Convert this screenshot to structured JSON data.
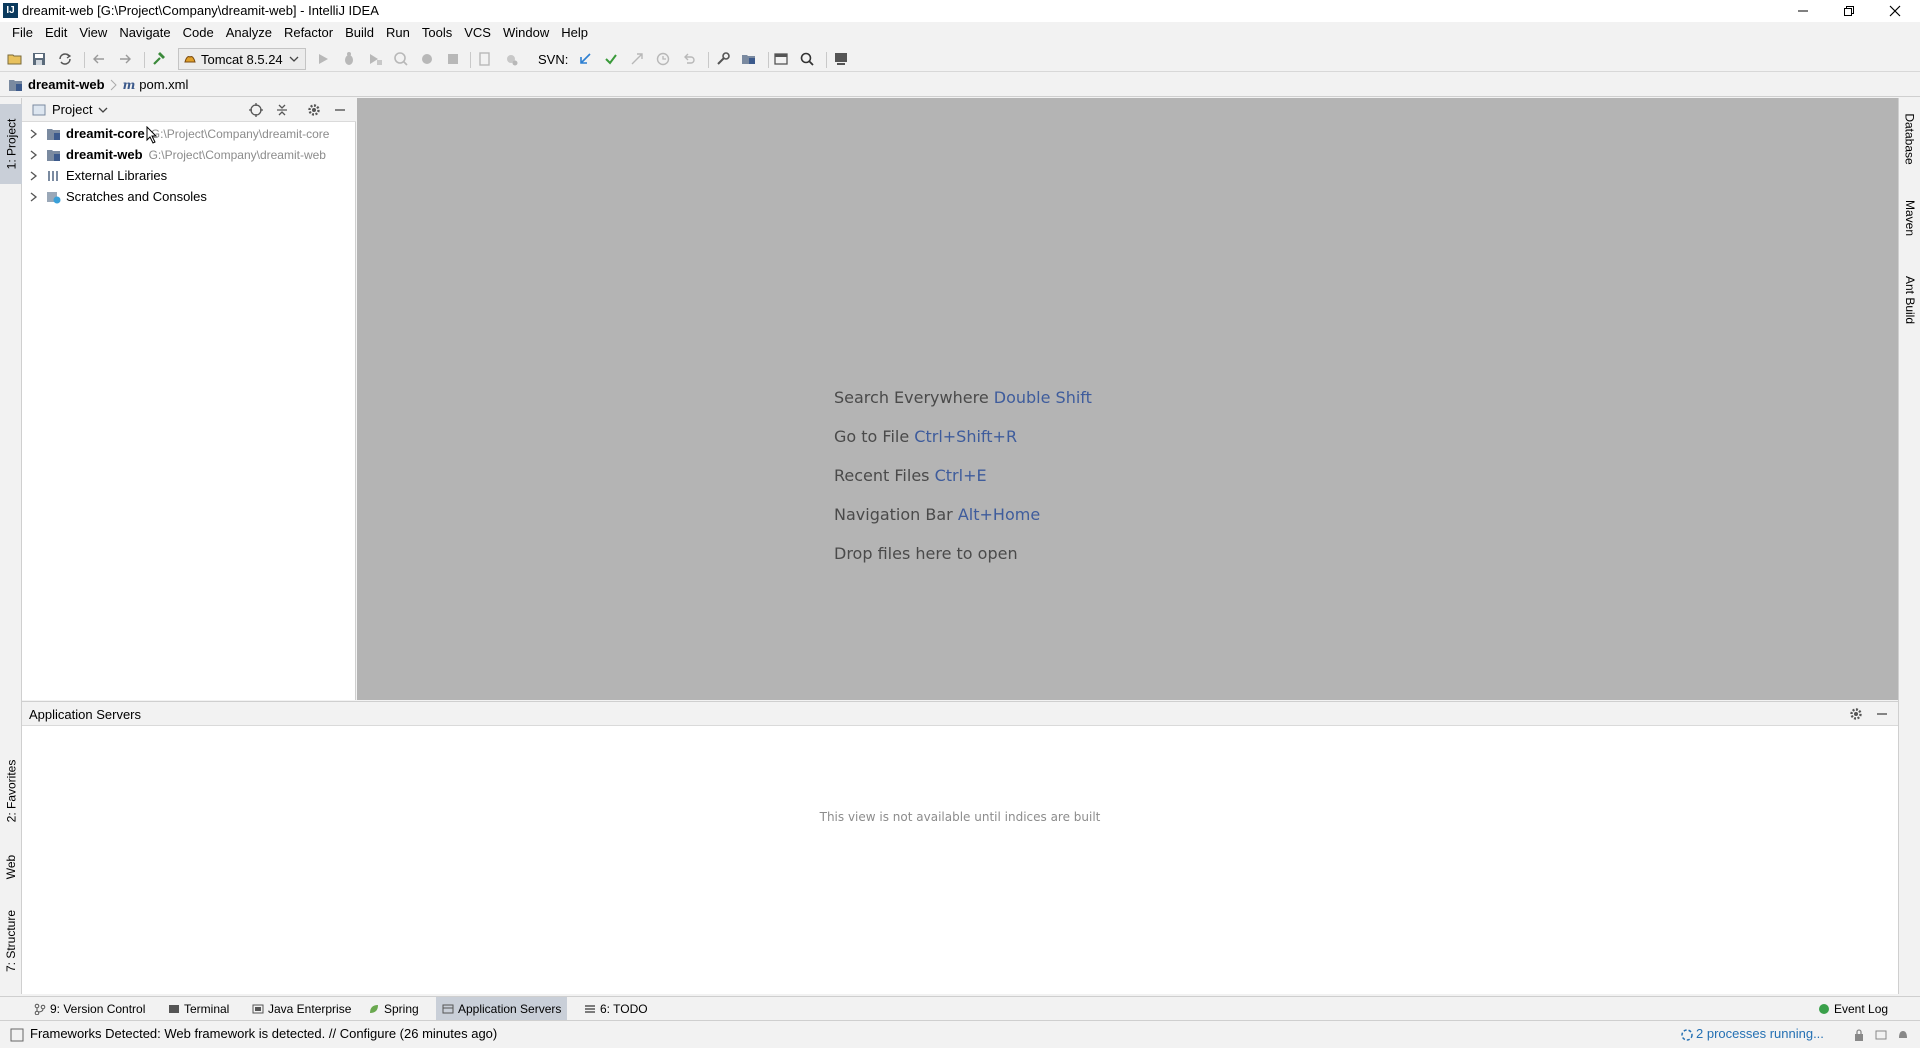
{
  "window": {
    "title": "dreamit-web [G:\\Project\\Company\\dreamit-web] - IntelliJ IDEA",
    "app_icon_letter": "IJ"
  },
  "menu": [
    "File",
    "Edit",
    "View",
    "Navigate",
    "Code",
    "Analyze",
    "Refactor",
    "Build",
    "Run",
    "Tools",
    "VCS",
    "Window",
    "Help"
  ],
  "toolbar": {
    "run_config": "Tomcat 8.5.24",
    "svn_label": "SVN:"
  },
  "breadcrumb": {
    "project": "dreamit-web",
    "file": "pom.xml"
  },
  "left_stripe": {
    "project_tab": "1: Project",
    "favorites_tab": "2: Favorites",
    "web_tab": "Web",
    "structure_tab": "7: Structure"
  },
  "right_stripe": {
    "database_tab": "Database",
    "maven_tab": "Maven",
    "ant_tab": "Ant Build"
  },
  "project_panel": {
    "view_label": "Project",
    "tree": [
      {
        "name": "dreamit-core",
        "path": "G:\\Project\\Company\\dreamit-core"
      },
      {
        "name": "dreamit-web",
        "path": "G:\\Project\\Company\\dreamit-web"
      },
      {
        "name": "External Libraries",
        "path": ""
      },
      {
        "name": "Scratches and Consoles",
        "path": ""
      }
    ]
  },
  "editor_hints": [
    {
      "text": "Search Everywhere",
      "shortcut": "Double Shift"
    },
    {
      "text": "Go to File",
      "shortcut": "Ctrl+Shift+R"
    },
    {
      "text": "Recent Files",
      "shortcut": "Ctrl+E"
    },
    {
      "text": "Navigation Bar",
      "shortcut": "Alt+Home"
    },
    {
      "text": "Drop files here to open",
      "shortcut": ""
    }
  ],
  "servers_panel": {
    "title": "Application Servers",
    "message": "This view is not available until indices are built"
  },
  "bottom_tabs": [
    {
      "label": "9: Version Control",
      "active": false
    },
    {
      "label": "Terminal",
      "active": false
    },
    {
      "label": "Java Enterprise",
      "active": false
    },
    {
      "label": "Spring",
      "active": false
    },
    {
      "label": "Application Servers",
      "active": true
    },
    {
      "label": "6: TODO",
      "active": false
    }
  ],
  "event_log": "Event Log",
  "status": {
    "message": "Frameworks Detected: Web framework is detected. // Configure (26 minutes ago)",
    "processes": "2 processes running..."
  },
  "colors": {
    "accent": "#3e5c9c",
    "editor_bg": "#b4b4b4",
    "link": "#2470b3",
    "active_tab": "#c9cfd8"
  }
}
